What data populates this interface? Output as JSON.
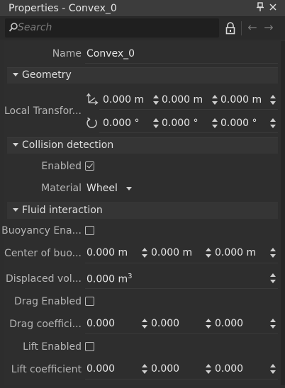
{
  "window": {
    "title": "Properties - Convex_0",
    "pin_icon": "pin-icon",
    "close_icon": "close-icon"
  },
  "toolbar": {
    "search_placeholder": "Search",
    "back_arrow": "←",
    "forward_arrow": "→"
  },
  "name_row": {
    "label": "Name",
    "value": "Convex_0"
  },
  "geometry": {
    "title": "Geometry",
    "local_transform": {
      "label": "Local Transfor...",
      "position": [
        "0.000 m",
        "0.000 m",
        "0.000 m"
      ],
      "rotation": [
        "0.000 °",
        "0.000 °",
        "0.000 °"
      ]
    }
  },
  "collision": {
    "title": "Collision detection",
    "enabled": {
      "label": "Enabled",
      "checked": true
    },
    "material": {
      "label": "Material",
      "value": "Wheel"
    }
  },
  "fluid": {
    "title": "Fluid interaction",
    "buoyancy_enabled": {
      "label": "Buoyancy Ena...",
      "checked": false
    },
    "center_of_buoyancy": {
      "label": "Center of buo...",
      "values": [
        "0.000 m",
        "0.000 m",
        "0.000 m"
      ]
    },
    "displaced_volume": {
      "label": "Displaced vol...",
      "value": "0.000 m",
      "unit_sup": "3"
    },
    "drag_enabled": {
      "label": "Drag Enabled",
      "checked": false
    },
    "drag_coefficient": {
      "label": "Drag coeffici...",
      "values": [
        "0.000",
        "0.000",
        "0.000"
      ]
    },
    "lift_enabled": {
      "label": "Lift Enabled",
      "checked": false
    },
    "lift_coefficient": {
      "label": "Lift coefficient",
      "values": [
        "0.000",
        "0.000",
        "0.000"
      ]
    }
  }
}
